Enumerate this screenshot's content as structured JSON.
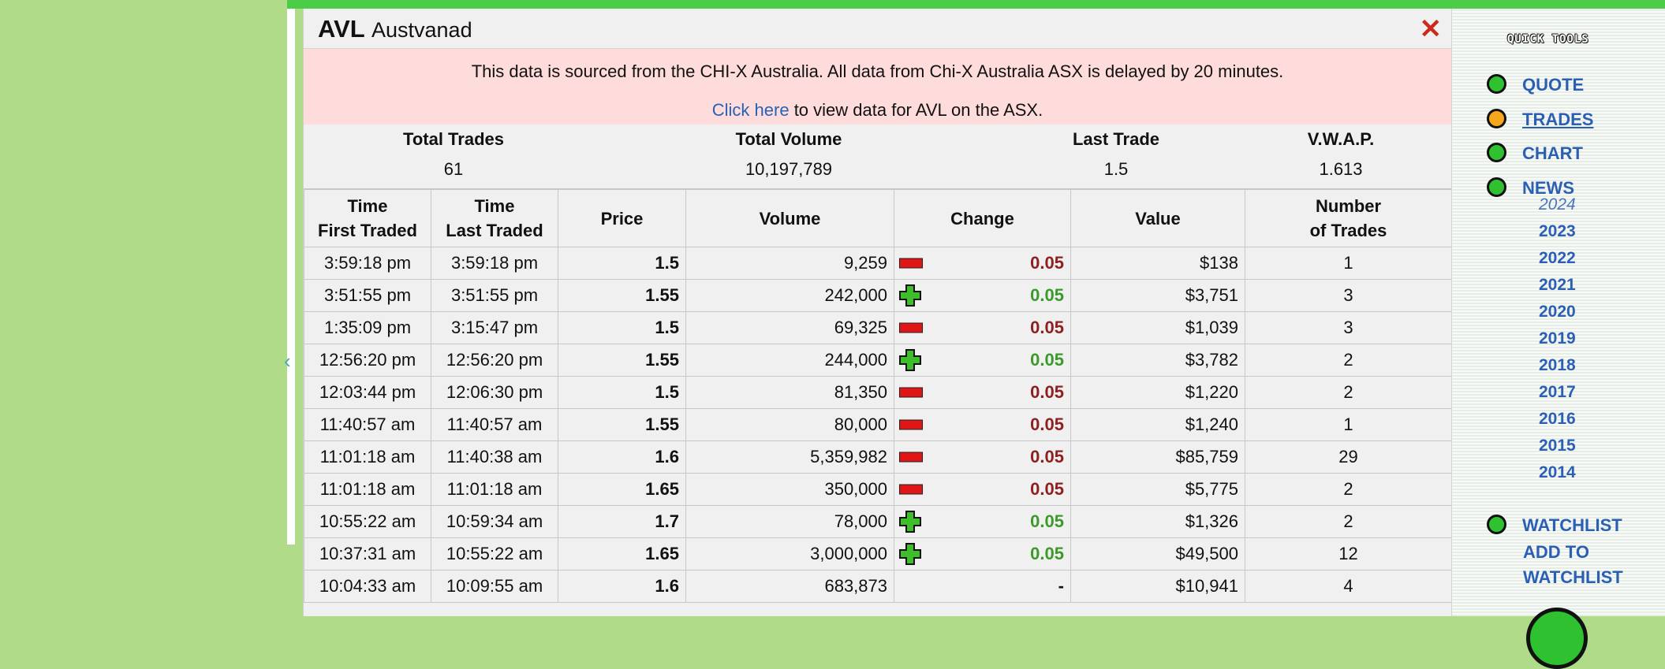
{
  "header": {
    "code": "AVL",
    "name": "Austvanad",
    "close_glyph": "✕"
  },
  "notice": {
    "line1": "This data is sourced from the CHI-X Australia. All data from Chi-X Australia ASX is delayed by 20 minutes.",
    "link_text": "Click here",
    "line2_rest": " to view data for AVL on the ASX."
  },
  "summary": {
    "total_trades_label": "Total Trades",
    "total_trades": "61",
    "total_volume_label": "Total Volume",
    "total_volume": "10,197,789",
    "last_trade_label": "Last Trade",
    "last_trade": "1.5",
    "vwap_label": "V.W.A.P.",
    "vwap": "1.613"
  },
  "table": {
    "headers": {
      "first_traded_1": "Time",
      "first_traded_2": "First Traded",
      "last_traded_1": "Time",
      "last_traded_2": "Last Traded",
      "price": "Price",
      "volume": "Volume",
      "change": "Change",
      "value": "Value",
      "trades_1": "Number",
      "trades_2": "of Trades"
    },
    "rows": [
      {
        "first": "3:59:18 pm",
        "last": "3:59:18 pm",
        "price": "1.5",
        "volume": "9,259",
        "dir": "down",
        "change": "0.05",
        "value": "$138",
        "trades": "1"
      },
      {
        "first": "3:51:55 pm",
        "last": "3:51:55 pm",
        "price": "1.55",
        "volume": "242,000",
        "dir": "up",
        "change": "0.05",
        "value": "$3,751",
        "trades": "3"
      },
      {
        "first": "1:35:09 pm",
        "last": "3:15:47 pm",
        "price": "1.5",
        "volume": "69,325",
        "dir": "down",
        "change": "0.05",
        "value": "$1,039",
        "trades": "3"
      },
      {
        "first": "12:56:20 pm",
        "last": "12:56:20 pm",
        "price": "1.55",
        "volume": "244,000",
        "dir": "up",
        "change": "0.05",
        "value": "$3,782",
        "trades": "2"
      },
      {
        "first": "12:03:44 pm",
        "last": "12:06:30 pm",
        "price": "1.5",
        "volume": "81,350",
        "dir": "down",
        "change": "0.05",
        "value": "$1,220",
        "trades": "2"
      },
      {
        "first": "11:40:57 am",
        "last": "11:40:57 am",
        "price": "1.55",
        "volume": "80,000",
        "dir": "down",
        "change": "0.05",
        "value": "$1,240",
        "trades": "1"
      },
      {
        "first": "11:01:18 am",
        "last": "11:40:38 am",
        "price": "1.6",
        "volume": "5,359,982",
        "dir": "down",
        "change": "0.05",
        "value": "$85,759",
        "trades": "29"
      },
      {
        "first": "11:01:18 am",
        "last": "11:01:18 am",
        "price": "1.65",
        "volume": "350,000",
        "dir": "down",
        "change": "0.05",
        "value": "$5,775",
        "trades": "2"
      },
      {
        "first": "10:55:22 am",
        "last": "10:59:34 am",
        "price": "1.7",
        "volume": "78,000",
        "dir": "up",
        "change": "0.05",
        "value": "$1,326",
        "trades": "2"
      },
      {
        "first": "10:37:31 am",
        "last": "10:55:22 am",
        "price": "1.65",
        "volume": "3,000,000",
        "dir": "up",
        "change": "0.05",
        "value": "$49,500",
        "trades": "12"
      },
      {
        "first": "10:04:33 am",
        "last": "10:09:55 am",
        "price": "1.6",
        "volume": "683,873",
        "dir": "none",
        "change": "-",
        "value": "$10,941",
        "trades": "4"
      }
    ]
  },
  "sidebar": {
    "title": "QUICK TOOLS",
    "quote": "QUOTE",
    "trades": "TRADES",
    "chart": "CHART",
    "news": "NEWS",
    "years": [
      "2024",
      "2023",
      "2022",
      "2021",
      "2020",
      "2019",
      "2018",
      "2017",
      "2016",
      "2015",
      "2014"
    ],
    "watchlist": "WATCHLIST",
    "add_to_1": "ADD TO",
    "add_to_2": "WATCHLIST"
  },
  "colors": {
    "background_green": "#b0dc8a",
    "top_strip": "#4ccd48",
    "notice_pink": "#ffdcdc",
    "link_blue": "#2b5fb3",
    "change_down": "#8e2020",
    "change_up": "#3b9a2a",
    "close_red": "#cc2a1a"
  }
}
